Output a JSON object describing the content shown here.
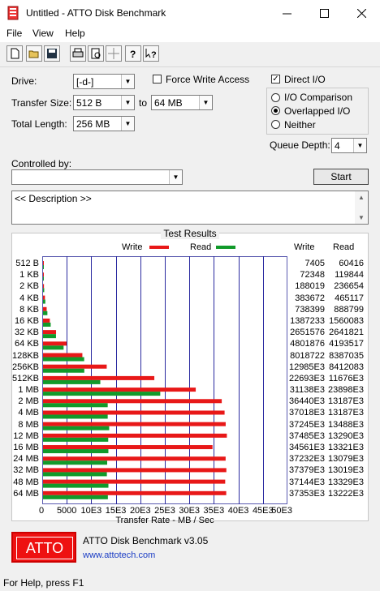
{
  "window": {
    "title": "Untitled - ATTO Disk Benchmark",
    "minimize_icon": "minimize-icon",
    "maximize_icon": "maximize-icon",
    "close_icon": "close-icon"
  },
  "menu": {
    "file": "File",
    "view": "View",
    "help": "Help"
  },
  "toolbar": {
    "icons": [
      "new-icon",
      "open-icon",
      "save-icon",
      "print-icon",
      "print-preview-icon",
      "move-icon",
      "help-icon",
      "context-help-icon"
    ]
  },
  "settings": {
    "drive_label": "Drive:",
    "drive_value": "[-d-]",
    "transfer_size_label": "Transfer Size:",
    "transfer_from": "512 B",
    "to_label": "to",
    "transfer_to": "64 MB",
    "total_length_label": "Total Length:",
    "total_length_value": "256 MB",
    "force_write_access": "Force Write Access",
    "force_write_checked": false,
    "direct_io": "Direct I/O",
    "direct_io_checked": true,
    "io_comparison": "I/O Comparison",
    "overlapped_io": "Overlapped I/O",
    "neither": "Neither",
    "selected_io_mode": "overlapped",
    "queue_depth_label": "Queue Depth:",
    "queue_depth_value": "4",
    "controlled_by_label": "Controlled by:",
    "controlled_by_value": "",
    "start_button": "Start",
    "description": "<< Description >>"
  },
  "results": {
    "title": "Test Results",
    "legend_write": "Write",
    "legend_read": "Read",
    "col_write": "Write",
    "col_read": "Read",
    "xlabel": "Transfer Rate - MB / Sec",
    "ticks": [
      "0",
      "5000",
      "10E3",
      "15E3",
      "20E3",
      "25E3",
      "30E3",
      "35E3",
      "40E3",
      "45E3",
      "50E3"
    ],
    "colors": {
      "write": "#e81818",
      "read": "#119a2a"
    }
  },
  "chart_data": {
    "type": "bar",
    "xlabel": "Transfer Rate - MB / Sec",
    "xlim": [
      0,
      50000
    ],
    "categories": [
      "512 B",
      "1 KB",
      "2 KB",
      "4 KB",
      "8 KB",
      "16 KB",
      "32 KB",
      "64 KB",
      "128KB",
      "256KB",
      "512KB",
      "1 MB",
      "2 MB",
      "4 MB",
      "8 MB",
      "12 MB",
      "16 MB",
      "24 MB",
      "32 MB",
      "48 MB",
      "64 MB"
    ],
    "series": [
      {
        "name": "Write",
        "values": [
          7.4,
          72.3,
          188.0,
          383.7,
          738.4,
          1387.2,
          2651.6,
          4801.9,
          8018.7,
          12985,
          22693,
          31138,
          36440,
          37018,
          37245,
          37485,
          34561,
          37232,
          37379,
          37144,
          37353
        ]
      },
      {
        "name": "Read",
        "values": [
          60.4,
          119.8,
          236.7,
          465.1,
          888.8,
          1560.1,
          2641.8,
          4193.5,
          8387.0,
          8412.1,
          11676,
          23898,
          13187,
          13187,
          13488,
          13290,
          13321,
          13079,
          13019,
          13329,
          13222
        ]
      }
    ],
    "write_text": [
      "7405",
      "72348",
      "188019",
      "383672",
      "738399",
      "1387233",
      "2651576",
      "4801876",
      "8018722",
      "12985E3",
      "22693E3",
      "31138E3",
      "36440E3",
      "37018E3",
      "37245E3",
      "37485E3",
      "34561E3",
      "37232E3",
      "37379E3",
      "37144E3",
      "37353E3"
    ],
    "read_text": [
      "60416",
      "119844",
      "236654",
      "465117",
      "888799",
      "1560083",
      "2641821",
      "4193517",
      "8387035",
      "8412083",
      "11676E3",
      "23898E3",
      "13187E3",
      "13187E3",
      "13488E3",
      "13290E3",
      "13321E3",
      "13079E3",
      "13019E3",
      "13329E3",
      "13222E3"
    ]
  },
  "footer": {
    "logo_text": "ATTO",
    "product": "ATTO Disk Benchmark v3.05",
    "link": "www.attotech.com"
  },
  "status": {
    "text": "For Help, press F1"
  }
}
